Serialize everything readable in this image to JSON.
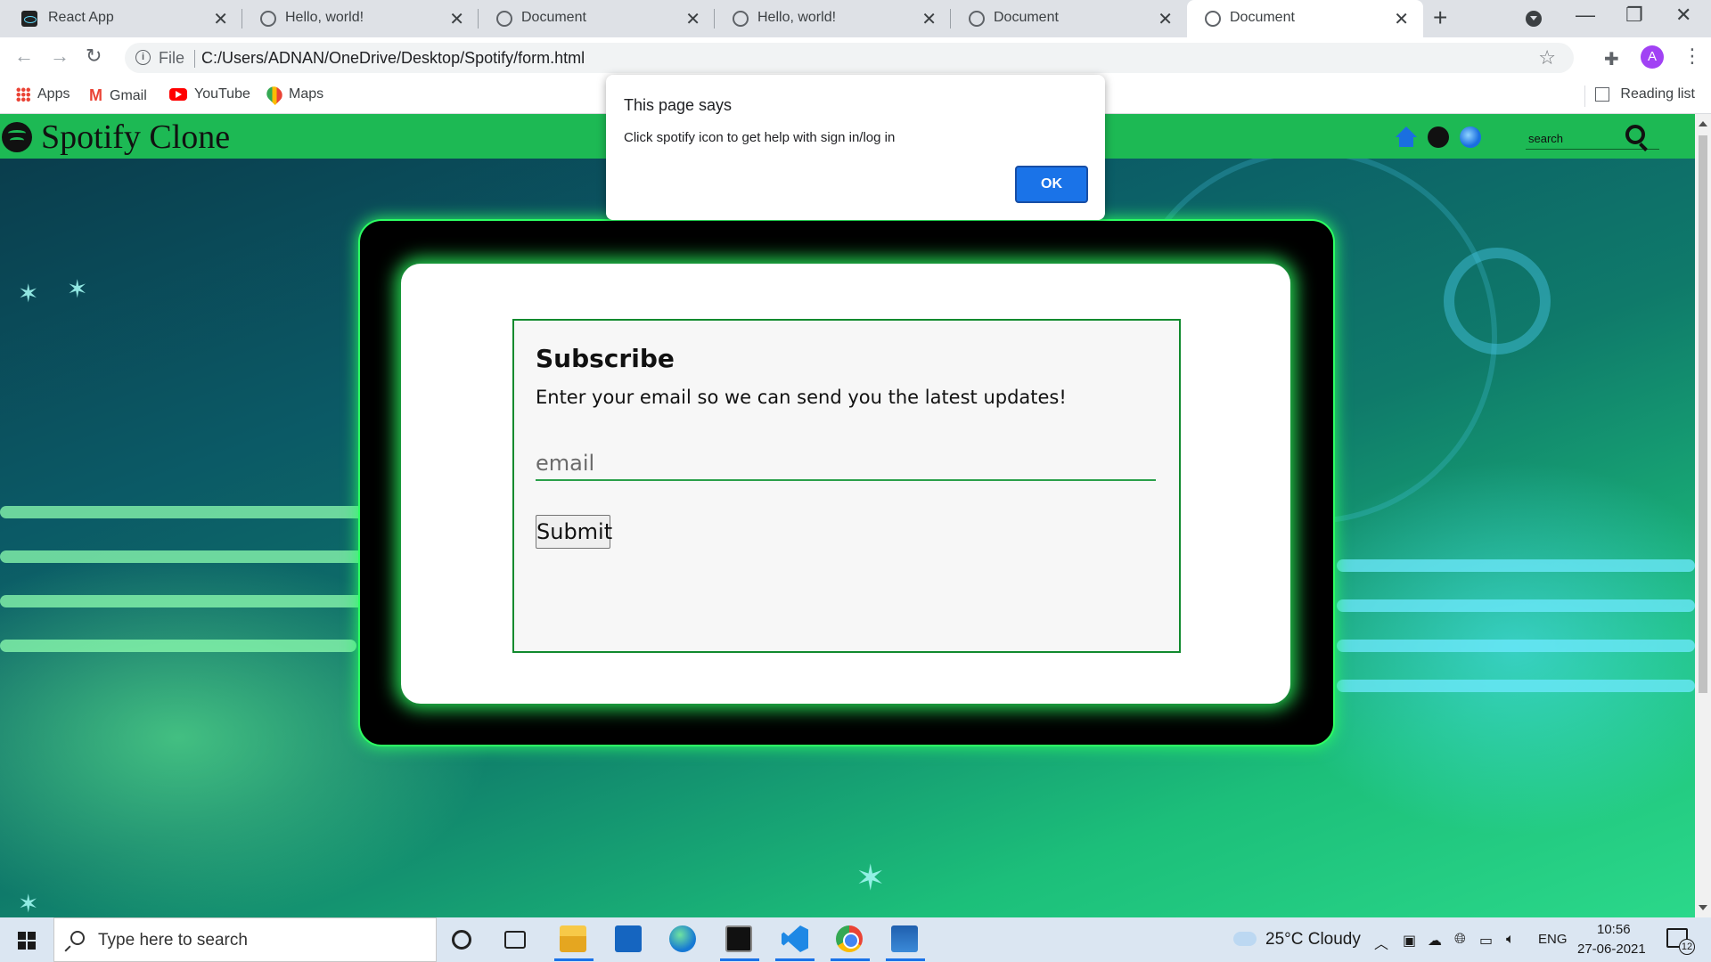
{
  "browser": {
    "tabs": [
      {
        "title": "React App",
        "icon": "react-icon",
        "active": false
      },
      {
        "title": "Hello, world!",
        "icon": "globe-icon",
        "active": false
      },
      {
        "title": "Document",
        "icon": "globe-icon",
        "active": false
      },
      {
        "title": "Hello, world!",
        "icon": "globe-icon",
        "active": false
      },
      {
        "title": "Document",
        "icon": "globe-icon",
        "active": false
      },
      {
        "title": "Document",
        "icon": "globe-icon",
        "active": true
      }
    ],
    "address": {
      "scheme": "File",
      "url": "C:/Users/ADNAN/OneDrive/Desktop/Spotify/form.html"
    },
    "profile_initial": "A",
    "bookmarks": [
      {
        "label": "Apps",
        "icon": "apps-grid-icon"
      },
      {
        "label": "Gmail",
        "icon": "gmail-icon"
      },
      {
        "label": "YouTube",
        "icon": "youtube-icon"
      },
      {
        "label": "Maps",
        "icon": "maps-icon"
      }
    ],
    "reading_list": "Reading list"
  },
  "page": {
    "brand": "Spotify Clone",
    "search_placeholder": "search",
    "form": {
      "title": "Subscribe",
      "description": "Enter your email so we can send you the latest updates!",
      "email_placeholder": "email",
      "submit_label": "Submit"
    },
    "colors": {
      "navbar": "#1db954",
      "frame_glow": "#2cff63",
      "form_border": "#118a2e"
    }
  },
  "alert": {
    "title": "This page says",
    "message": "Click spotify icon to get help with sign in/log in",
    "ok_label": "OK"
  },
  "taskbar": {
    "search_placeholder": "Type here to search",
    "weather": "25°C  Cloudy",
    "language": "ENG",
    "time": "10:56",
    "date": "27-06-2021",
    "notification_count": "12"
  }
}
